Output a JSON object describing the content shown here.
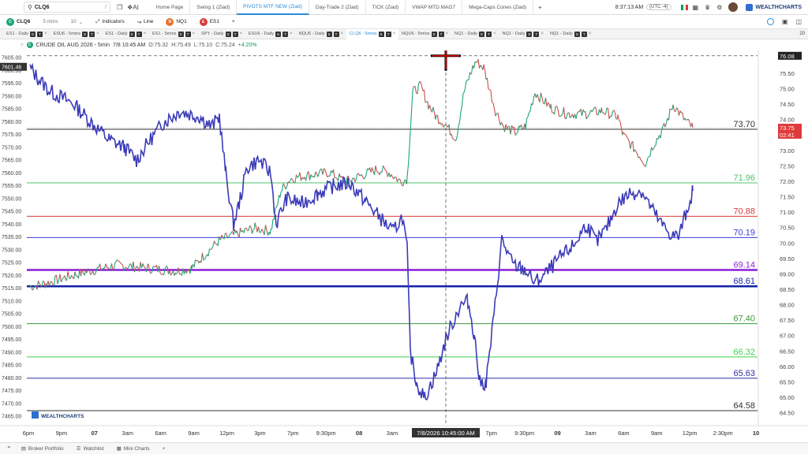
{
  "topbar": {
    "symbol": "CLQ6",
    "tabs": [
      "Home Page",
      "Swing 1 (Ziad)",
      "PIVOTS MTF NEW (Ziad)",
      "Day-Trade 2 (Ziad)",
      "TICK (Ziad)",
      "VWAP MTD MAG7",
      "Mega-Caps Cones (Ziad)"
    ],
    "active_tab": 2,
    "add": "+",
    "clock": "8:37:13 AM",
    "tz": "(UTC -4)",
    "brand": "WEALTHCHARTS"
  },
  "toolbar2": {
    "symbol": "CLQ6",
    "interval": "5 mins",
    "bars": "10",
    "indicators_label": "Indicators",
    "charttype_label": "Line",
    "cmp1": "NQ1",
    "cmp2": "ES1",
    "add": "+"
  },
  "chart_tabs": [
    "ES1 - Daily",
    "ESU6 - 5mins",
    "ES1 - Daily",
    "ES1 - 5mins",
    "SPY - Daily",
    "ESU6 - Daily",
    "NQU6 - Daily",
    "CLQ6 - 5mins",
    "NQU6 - 5mins",
    "NQ1 - Daily",
    "NQ1 - Daily",
    "NQ1 - Daily"
  ],
  "active_chart_tab": 7,
  "chart_tabs_right": "20",
  "legend": {
    "title": "CRUDE OIL AUG 2026 - 5min",
    "date": "7/8 10:45 AM",
    "o": "O:75.32",
    "h": "H:75.49",
    "l": "L:75.10",
    "c": "C:75.24",
    "chg": "+4.20%"
  },
  "chart_data": {
    "type": "line",
    "price_axis": {
      "min": 64.4,
      "max": 76.1,
      "ticks": [
        "75.50",
        "75.00",
        "74.50",
        "74.00",
        "73.50",
        "73.00",
        "72.50",
        "72.00",
        "71.50",
        "71.00",
        "70.50",
        "70.00",
        "69.50",
        "69.00",
        "68.50",
        "68.00",
        "67.50",
        "67.00",
        "66.50",
        "66.00",
        "65.50",
        "65.00",
        "64.50"
      ],
      "current_label": "76.08",
      "last_label": "73.75",
      "countdown": "02:41"
    },
    "tick_axis": {
      "min": 7465,
      "max": 7606,
      "ticks": [
        "7605.00",
        "7600.00",
        "7595.00",
        "7590.00",
        "7585.00",
        "7580.00",
        "7575.00",
        "7570.00",
        "7565.00",
        "7560.00",
        "7555.00",
        "7550.00",
        "7545.00",
        "7540.00",
        "7535.00",
        "7530.00",
        "7525.00",
        "7520.00",
        "7515.00",
        "7510.00",
        "7505.00",
        "7500.00",
        "7495.00",
        "7490.00",
        "7485.00",
        "7480.00",
        "7475.00",
        "7470.00",
        "7465.00"
      ],
      "crosshair_label": "7601.46"
    },
    "time_axis": {
      "labels": [
        "6pm",
        "9pm",
        "07",
        "3am",
        "6am",
        "9am",
        "12pm",
        "3pm",
        "7pm",
        "9:30pm",
        "08",
        "3am",
        "6am",
        "3pm",
        "7pm",
        "9:30pm",
        "09",
        "3am",
        "6am",
        "9am",
        "12pm",
        "2:30pm",
        "10"
      ],
      "bold": [
        "07",
        "08",
        "09",
        "10"
      ],
      "crosshair_label": "7/8/2026 10:45:00 AM"
    },
    "levels": [
      {
        "value": 73.7,
        "label": "73.70",
        "color": "#333333"
      },
      {
        "value": 71.96,
        "label": "71.96",
        "color": "#4cc36a"
      },
      {
        "value": 70.88,
        "label": "70.88",
        "color": "#d83a3a"
      },
      {
        "value": 70.19,
        "label": "70.19",
        "color": "#3a3ad8"
      },
      {
        "value": 69.14,
        "label": "69.14",
        "color": "#8a1fd6"
      },
      {
        "value": 68.61,
        "label": "68.61",
        "color": "#1420a8"
      },
      {
        "value": 67.4,
        "label": "67.40",
        "color": "#3a9a3a"
      },
      {
        "value": 66.32,
        "label": "66.32",
        "color": "#3fd24e"
      },
      {
        "value": 65.63,
        "label": "65.63",
        "color": "#2c2ca0"
      },
      {
        "value": 64.58,
        "label": "64.58",
        "color": "#333333"
      }
    ],
    "price_series_keyframes": [
      [
        0,
        68.6
      ],
      [
        20,
        68.7
      ],
      [
        45,
        68.9
      ],
      [
        75,
        69.1
      ],
      [
        110,
        69.3
      ],
      [
        150,
        69.2
      ],
      [
        185,
        69.1
      ],
      [
        205,
        69.2
      ],
      [
        220,
        69.6
      ],
      [
        240,
        70.1
      ],
      [
        262,
        70.3
      ],
      [
        285,
        70.5
      ],
      [
        305,
        70.4
      ],
      [
        318,
        71.7
      ],
      [
        330,
        72.1
      ],
      [
        350,
        72.2
      ],
      [
        380,
        72.3
      ],
      [
        400,
        72.0
      ],
      [
        420,
        72.2
      ],
      [
        440,
        72.4
      ],
      [
        455,
        72.3
      ],
      [
        470,
        72.0
      ],
      [
        478,
        72.1
      ],
      [
        485,
        74.9
      ],
      [
        495,
        75.1
      ],
      [
        505,
        74.5
      ],
      [
        515,
        74.1
      ],
      [
        525,
        73.9
      ],
      [
        540,
        73.4
      ],
      [
        550,
        74.9
      ],
      [
        558,
        75.5
      ],
      [
        565,
        75.9
      ],
      [
        575,
        75.7
      ],
      [
        590,
        74.3
      ],
      [
        600,
        73.8
      ],
      [
        615,
        73.6
      ],
      [
        628,
        73.8
      ],
      [
        640,
        74.9
      ],
      [
        660,
        74.4
      ],
      [
        680,
        74.2
      ],
      [
        705,
        74.2
      ],
      [
        725,
        74.3
      ],
      [
        745,
        74.1
      ],
      [
        752,
        73.5
      ],
      [
        765,
        73.1
      ],
      [
        780,
        72.6
      ],
      [
        790,
        73.2
      ],
      [
        805,
        73.8
      ],
      [
        815,
        74.5
      ],
      [
        830,
        74.0
      ],
      [
        840,
        73.75
      ]
    ],
    "ticks_series_keyframes": [
      [
        0,
        7601
      ],
      [
        10,
        7597
      ],
      [
        25,
        7592
      ],
      [
        55,
        7587
      ],
      [
        80,
        7579
      ],
      [
        100,
        7573
      ],
      [
        120,
        7570
      ],
      [
        135,
        7565
      ],
      [
        150,
        7572
      ],
      [
        170,
        7580
      ],
      [
        190,
        7584
      ],
      [
        215,
        7582
      ],
      [
        230,
        7578
      ],
      [
        240,
        7582
      ],
      [
        248,
        7560
      ],
      [
        258,
        7540
      ],
      [
        265,
        7548
      ],
      [
        275,
        7562
      ],
      [
        290,
        7565
      ],
      [
        305,
        7560
      ],
      [
        312,
        7540
      ],
      [
        325,
        7550
      ],
      [
        345,
        7548
      ],
      [
        365,
        7552
      ],
      [
        385,
        7555
      ],
      [
        405,
        7556
      ],
      [
        425,
        7549
      ],
      [
        445,
        7542
      ],
      [
        460,
        7537
      ],
      [
        472,
        7543
      ],
      [
        478,
        7530
      ],
      [
        482,
        7490
      ],
      [
        490,
        7478
      ],
      [
        500,
        7472
      ],
      [
        515,
        7482
      ],
      [
        528,
        7496
      ],
      [
        545,
        7508
      ],
      [
        555,
        7510
      ],
      [
        563,
        7497
      ],
      [
        570,
        7478
      ],
      [
        578,
        7478
      ],
      [
        588,
        7504
      ],
      [
        598,
        7534
      ],
      [
        612,
        7524
      ],
      [
        628,
        7522
      ],
      [
        640,
        7517
      ],
      [
        655,
        7521
      ],
      [
        672,
        7527
      ],
      [
        690,
        7532
      ],
      [
        705,
        7540
      ],
      [
        718,
        7533
      ],
      [
        730,
        7538
      ],
      [
        745,
        7548
      ],
      [
        760,
        7552
      ],
      [
        775,
        7553
      ],
      [
        788,
        7546
      ],
      [
        800,
        7540
      ],
      [
        812,
        7536
      ],
      [
        822,
        7535
      ],
      [
        832,
        7545
      ],
      [
        840,
        7553
      ]
    ],
    "price_color_up": "#1aa577",
    "price_color_down": "#d14b4b",
    "ticks_color": "#3b3bb8",
    "grid": false
  },
  "bottombar": {
    "items": [
      "Broker Portfolio",
      "Watchlist",
      "Mini Charts"
    ],
    "add": "+"
  },
  "watermark": "WEALTHCHARTS"
}
